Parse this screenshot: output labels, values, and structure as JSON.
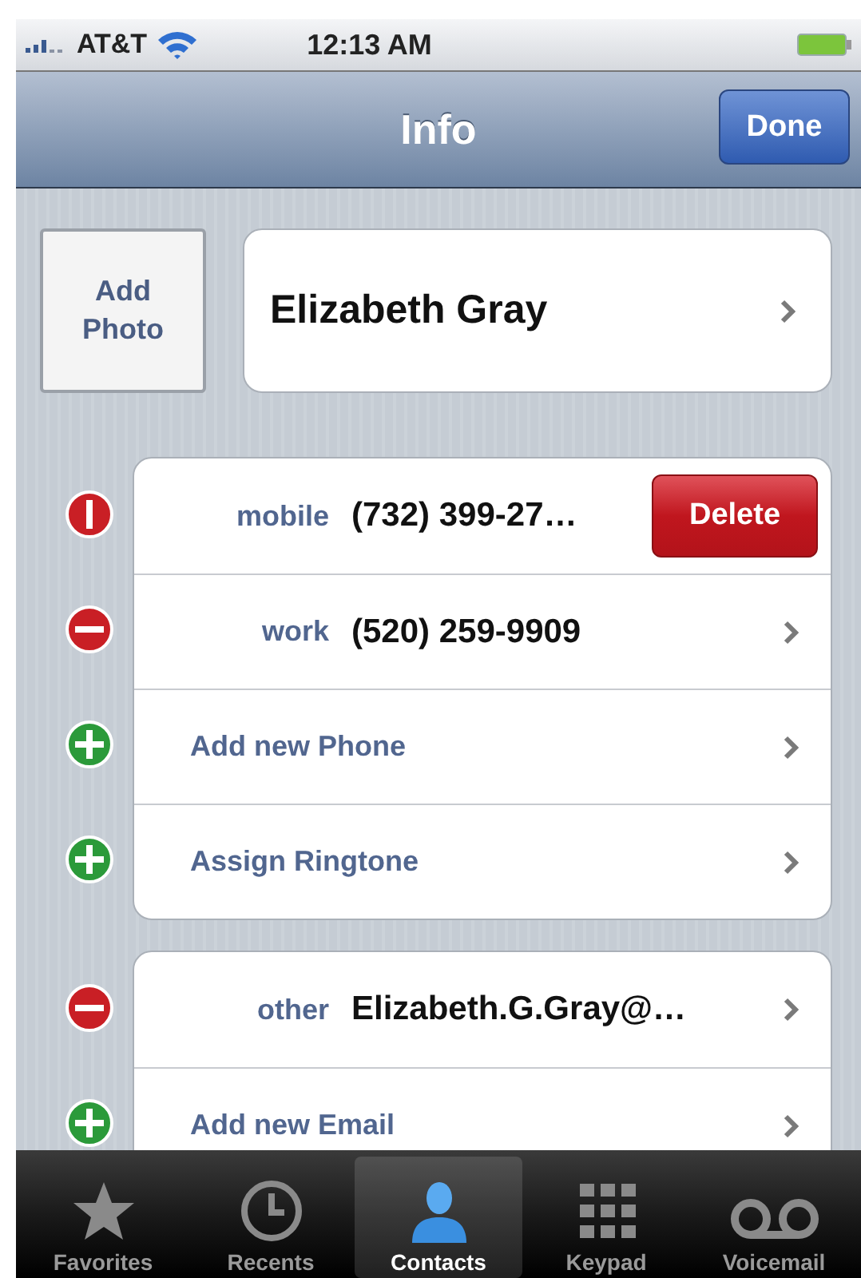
{
  "status_bar": {
    "carrier": "AT&T",
    "time": "12:13 AM"
  },
  "nav_bar": {
    "title": "Info",
    "done_button": "Done"
  },
  "header": {
    "photo_button": "Add Photo",
    "name": "Elizabeth Gray"
  },
  "groups": [
    {
      "rows": [
        {
          "kind": "field",
          "label": "mobile",
          "value": "(732) 399-27…",
          "delete_button": "Delete"
        },
        {
          "kind": "field",
          "label": "work",
          "value": "(520) 259-9909"
        },
        {
          "kind": "add",
          "label": "Add new Phone"
        },
        {
          "kind": "add",
          "label": "Assign Ringtone"
        }
      ]
    },
    {
      "rows": [
        {
          "kind": "field",
          "label": "other",
          "value": "Elizabeth.G.Gray@…"
        },
        {
          "kind": "add",
          "label": "Add new Email"
        }
      ]
    }
  ],
  "tab_bar": [
    {
      "kind": "star",
      "label": "Favorites",
      "selected": false
    },
    {
      "kind": "clock",
      "label": "Recents",
      "selected": false
    },
    {
      "kind": "person",
      "label": "Contacts",
      "selected": true
    },
    {
      "kind": "keypad",
      "label": "Keypad",
      "selected": false
    },
    {
      "kind": "voicemail",
      "label": "Voicemail",
      "selected": false
    }
  ]
}
